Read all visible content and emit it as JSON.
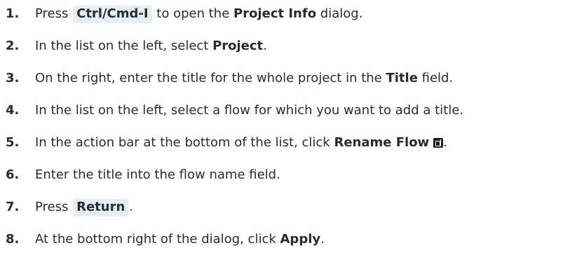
{
  "steps": [
    {
      "number": "1.",
      "parts": {
        "a": "Press ",
        "b": "Ctrl/Cmd-I",
        "c": " to open the ",
        "d": "Project Info",
        "e": " dialog."
      }
    },
    {
      "number": "2.",
      "parts": {
        "a": "In the list on the left, select ",
        "b": "Project",
        "c": "."
      }
    },
    {
      "number": "3.",
      "parts": {
        "a": "On the right, enter the title for the whole project in the ",
        "b": "Title",
        "c": " field."
      }
    },
    {
      "number": "4.",
      "parts": {
        "a": "In the list on the left, select a flow for which you want to add a title."
      }
    },
    {
      "number": "5.",
      "parts": {
        "a": "In the action bar at the bottom of the list, click ",
        "b": "Rename Flow",
        "c": "."
      },
      "icon": "rename-flow-icon"
    },
    {
      "number": "6.",
      "parts": {
        "a": "Enter the title into the flow name field."
      }
    },
    {
      "number": "7.",
      "parts": {
        "a": "Press ",
        "b": "Return",
        "c": "."
      }
    },
    {
      "number": "8.",
      "parts": {
        "a": "At the bottom right of the dialog, click ",
        "b": "Apply",
        "c": "."
      }
    }
  ]
}
